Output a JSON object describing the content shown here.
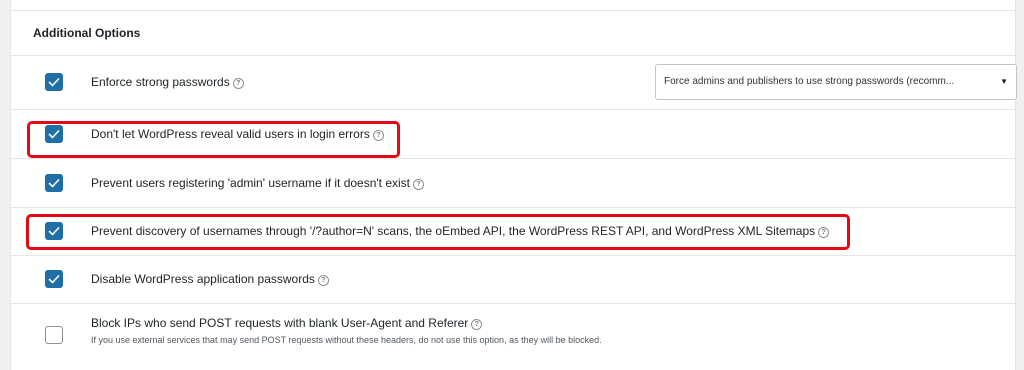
{
  "section": {
    "title": "Additional Options"
  },
  "options": [
    {
      "label": "Enforce strong passwords",
      "checked": true
    },
    {
      "label": "Don't let WordPress reveal valid users in login errors",
      "checked": true
    },
    {
      "label": "Prevent users registering 'admin' username if it doesn't exist",
      "checked": true
    },
    {
      "label": "Prevent discovery of usernames through '/?author=N' scans, the oEmbed API, the WordPress REST API, and WordPress XML Sitemaps",
      "checked": true
    },
    {
      "label": "Disable WordPress application passwords",
      "checked": true
    },
    {
      "label": "Block IPs who send POST requests with blank User-Agent and Referer",
      "checked": false,
      "description": "If you use external services that may send POST requests without these headers, do not use this option, as they will be blocked."
    }
  ],
  "strong_password_select": {
    "value": "Force admins and publishers to use strong passwords (recomm..."
  },
  "help_icon_glyph": "?",
  "colors": {
    "checkbox": "#1e6fa8",
    "highlight": "#e00b14"
  }
}
